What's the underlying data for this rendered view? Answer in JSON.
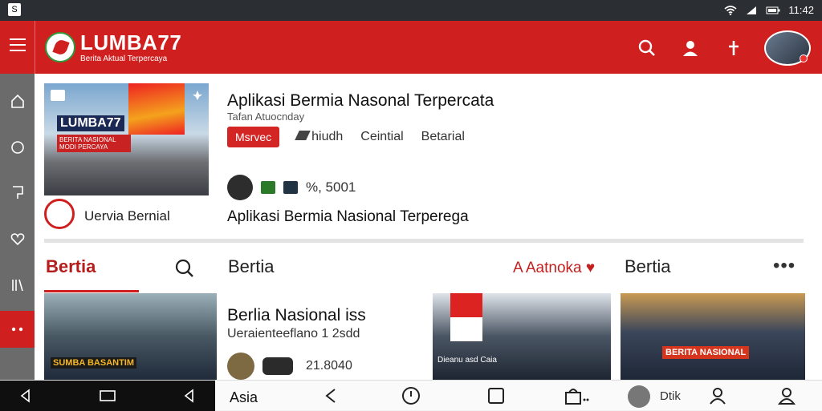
{
  "status_bar": {
    "left_icon": "S",
    "time": "11:42"
  },
  "app_bar": {
    "brand": "LUMBA77",
    "tagline": "Berita Aktual Terpercaya"
  },
  "feature": {
    "image_label": "LUMBA77",
    "image_sublabel": "BERITA NASIONAL MODI PERCAYA",
    "channel_name": "Uervia Bernial",
    "title": "Aplikasi Bermia Nasonal Terpercata",
    "subtitle": "Tafan Atuocnday",
    "chips": {
      "primary": "Msrvec",
      "c1": "hiudh",
      "c2": "Ceintial",
      "c3": "Betarial"
    },
    "meta_count": "%, 5001",
    "title2": "Aplikasi  Bermia Nasional Terperega"
  },
  "sections": {
    "left_title": "Bertia",
    "middle_title": "Bertia",
    "middle_link": "A Aatnoka",
    "right_title": "Bertia",
    "more": "•••"
  },
  "cards": {
    "card1_tag": "SUMBA BASANTIM",
    "card2_tag": "Dieanu asd Caia",
    "card3_tag": "BERITA NASIONAL",
    "middle_title": "Berlia Nasional iss",
    "middle_sub": "Ueraienteeflano  1  2sdd",
    "middle_count": "21.8040"
  },
  "bottom_nav": {
    "label": "Asia",
    "right_label": "Dtik"
  }
}
